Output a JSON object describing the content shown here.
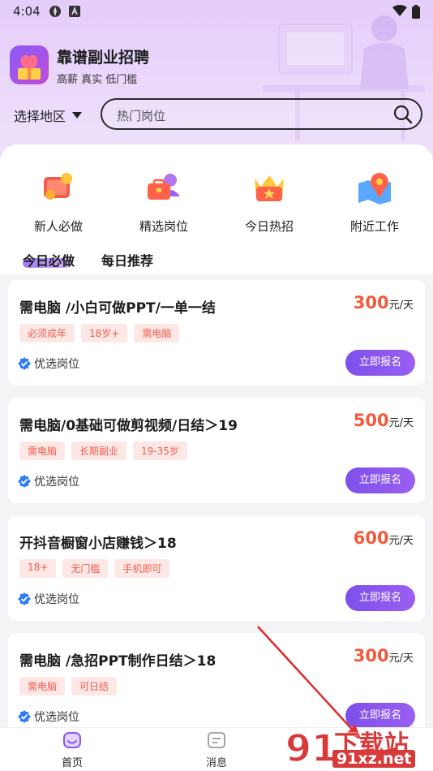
{
  "status": {
    "time": "4:04"
  },
  "app": {
    "name": "靠谱副业招聘",
    "slogan": "高薪 真实 低门槛"
  },
  "region": {
    "label": "选择地区"
  },
  "search": {
    "placeholder": "热门岗位"
  },
  "categories": [
    {
      "label": "新人必做",
      "icon": "wallet-coin-icon"
    },
    {
      "label": "精选岗位",
      "icon": "briefcase-person-icon"
    },
    {
      "label": "今日热招",
      "icon": "crown-star-icon"
    },
    {
      "label": "附近工作",
      "icon": "map-pin-icon"
    }
  ],
  "tabs": [
    {
      "label": "今日必做",
      "active": true
    },
    {
      "label": "每日推荐",
      "active": false
    }
  ],
  "jobs": [
    {
      "title": "需电脑 /小白可做PPT/一单一结",
      "amount": "300",
      "unit": "元/天",
      "tags": [
        "必须成年",
        "18岁+",
        "需电脑"
      ],
      "verified_label": "优选岗位",
      "apply_label": "立即报名"
    },
    {
      "title": "需电脑/0基础可做剪视频/日结＞19",
      "amount": "500",
      "unit": "元/天",
      "tags": [
        "需电脑",
        "长期副业",
        "19-35岁"
      ],
      "verified_label": "优选岗位",
      "apply_label": "立即报名"
    },
    {
      "title": "开抖音橱窗小店赚钱＞18",
      "amount": "600",
      "unit": "元/天",
      "tags": [
        "18+",
        "无门槛",
        "手机即可"
      ],
      "verified_label": "优选岗位",
      "apply_label": "立即报名"
    },
    {
      "title": "需电脑 /急招PPT制作日结＞18",
      "amount": "300",
      "unit": "元/天",
      "tags": [
        "需电脑",
        "可日结"
      ],
      "verified_label": "优选岗位",
      "apply_label": "立即报名"
    }
  ],
  "nav": [
    {
      "label": "首页",
      "active": true
    },
    {
      "label": "消息",
      "active": false
    }
  ],
  "watermark": {
    "brand": "下载站",
    "url": "91xz.net",
    "logo_text": "91"
  },
  "colors": {
    "accent": "#8a58ee",
    "salary": "#f25a3c",
    "tag_text": "#ef5c4c",
    "tag_bg": "#fde8e6"
  }
}
